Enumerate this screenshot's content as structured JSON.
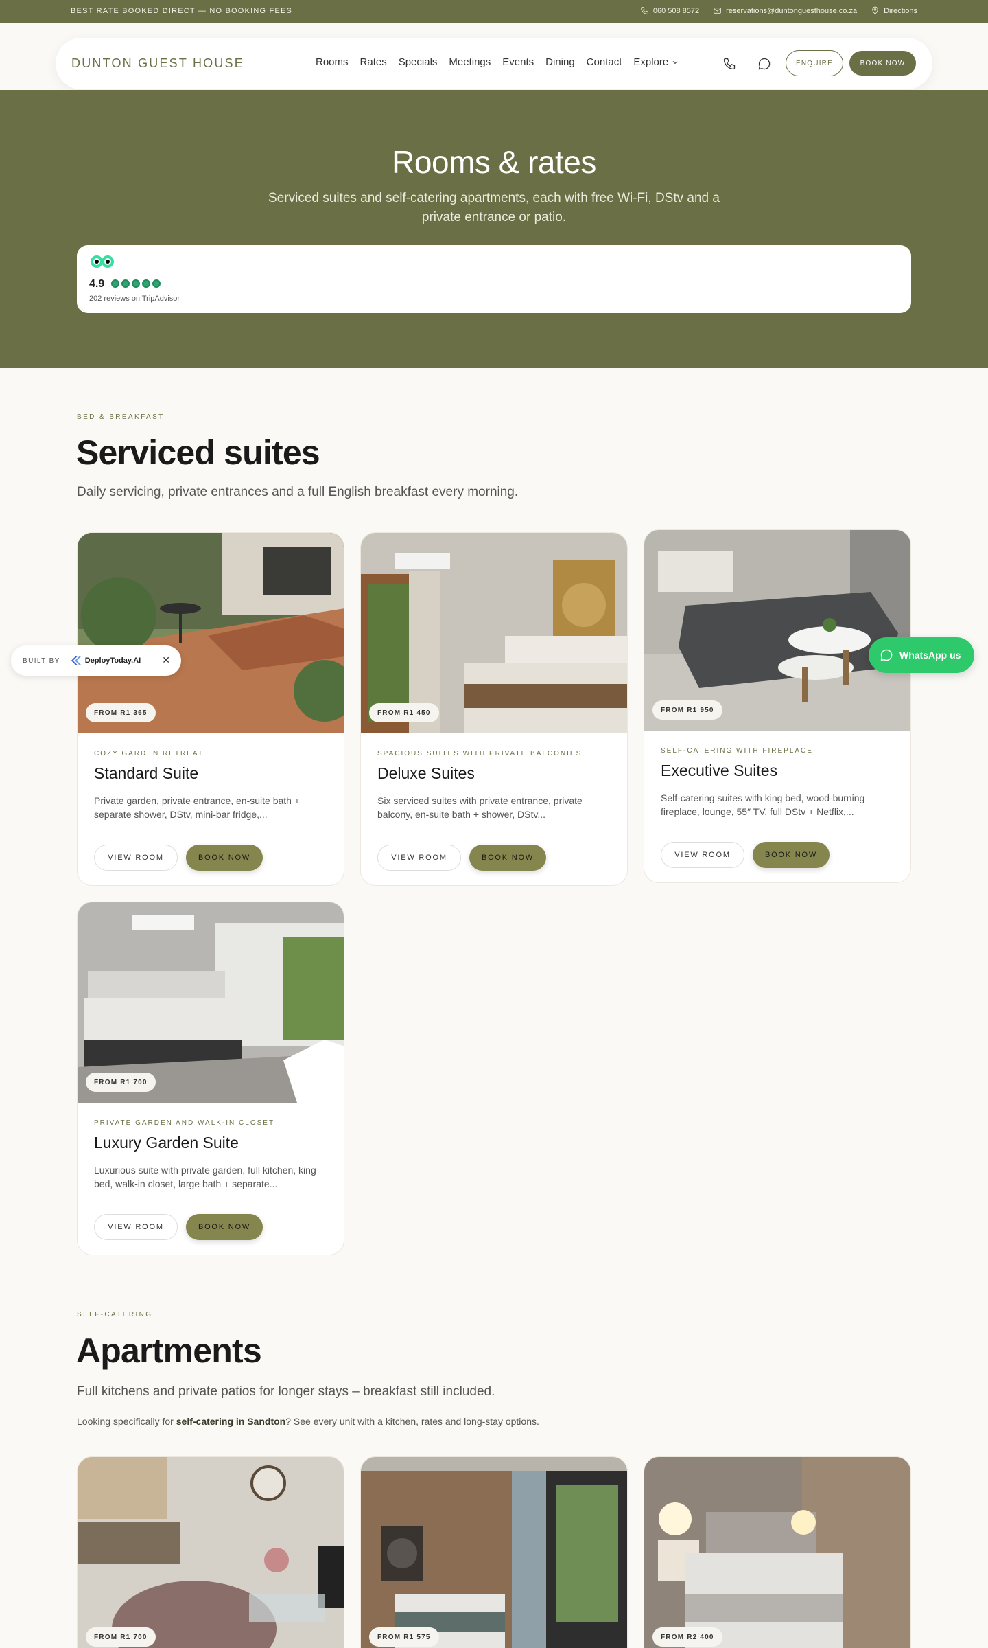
{
  "topbar": {
    "promo": "BEST RATE BOOKED DIRECT — NO BOOKING FEES",
    "phone": "060 508 8572",
    "email": "reservations@duntonguesthouse.co.za",
    "directions": "Directions"
  },
  "nav": {
    "brand": "DUNTON GUEST HOUSE",
    "links": [
      "Rooms",
      "Rates",
      "Specials",
      "Meetings",
      "Events",
      "Dining",
      "Contact"
    ],
    "explore": "Explore",
    "enquire": "ENQUIRE",
    "book": "BOOK NOW"
  },
  "hero": {
    "title": "Rooms & rates",
    "subtitle": "Serviced suites and self-catering apartments, each with free Wi-Fi, DStv and a private entrance or patio.",
    "rating": "4.9",
    "reviews": "202 reviews on TripAdvisor",
    "stars": 5
  },
  "suites": {
    "eyebrow": "BED & BREAKFAST",
    "title": "Serviced suites",
    "lead": "Daily servicing, private entrances and a full English breakfast every morning.",
    "cards": [
      {
        "price": "FROM R1 365",
        "tag": "COZY GARDEN RETREAT",
        "title": "Standard Suite",
        "desc": "Private garden, private entrance, en-suite bath + separate shower, DStv, mini-bar fridge,...",
        "view": "VIEW ROOM",
        "book": "BOOK NOW"
      },
      {
        "price": "FROM R1 450",
        "tag": "SPACIOUS SUITES WITH PRIVATE BALCONIES",
        "title": "Deluxe Suites",
        "desc": "Six serviced suites with private entrance, private balcony, en-suite bath + shower, DStv...",
        "view": "VIEW ROOM",
        "book": "BOOK NOW"
      },
      {
        "price": "FROM R1 950",
        "tag": "SELF-CATERING WITH FIREPLACE",
        "title": "Executive Suites",
        "desc": "Self-catering suites with king bed, wood-burning fireplace, lounge, 55″ TV, full DStv + Netflix,...",
        "view": "VIEW ROOM",
        "book": "BOOK NOW"
      },
      {
        "price": "FROM R1 700",
        "tag": "PRIVATE GARDEN AND WALK-IN CLOSET",
        "title": "Luxury Garden Suite",
        "desc": "Luxurious suite with private garden, full kitchen, king bed, walk-in closet, large bath + separate...",
        "view": "VIEW ROOM",
        "book": "BOOK NOW"
      }
    ]
  },
  "apartments": {
    "eyebrow": "SELF-CATERING",
    "title": "Apartments",
    "lead": "Full kitchens and private patios for longer stays – breakfast still included.",
    "note_pre": "Looking specifically for ",
    "note_link": "self-catering in Sandton",
    "note_post": "? See every unit with a kitchen, rates and long-stay options.",
    "cards": [
      {
        "price": "FROM R1 700"
      },
      {
        "price": "FROM R1 575"
      },
      {
        "price": "FROM R2 400"
      }
    ]
  },
  "floating": {
    "built_by": "BUILT BY",
    "builder": "DeployToday.AI",
    "close": "✕",
    "whatsapp": "WhatsApp us"
  },
  "colors": {
    "brand": "#6b6f45",
    "accent_button": "#84864d",
    "whatsapp": "#2ec96a",
    "tripadvisor": "#2fa572"
  }
}
